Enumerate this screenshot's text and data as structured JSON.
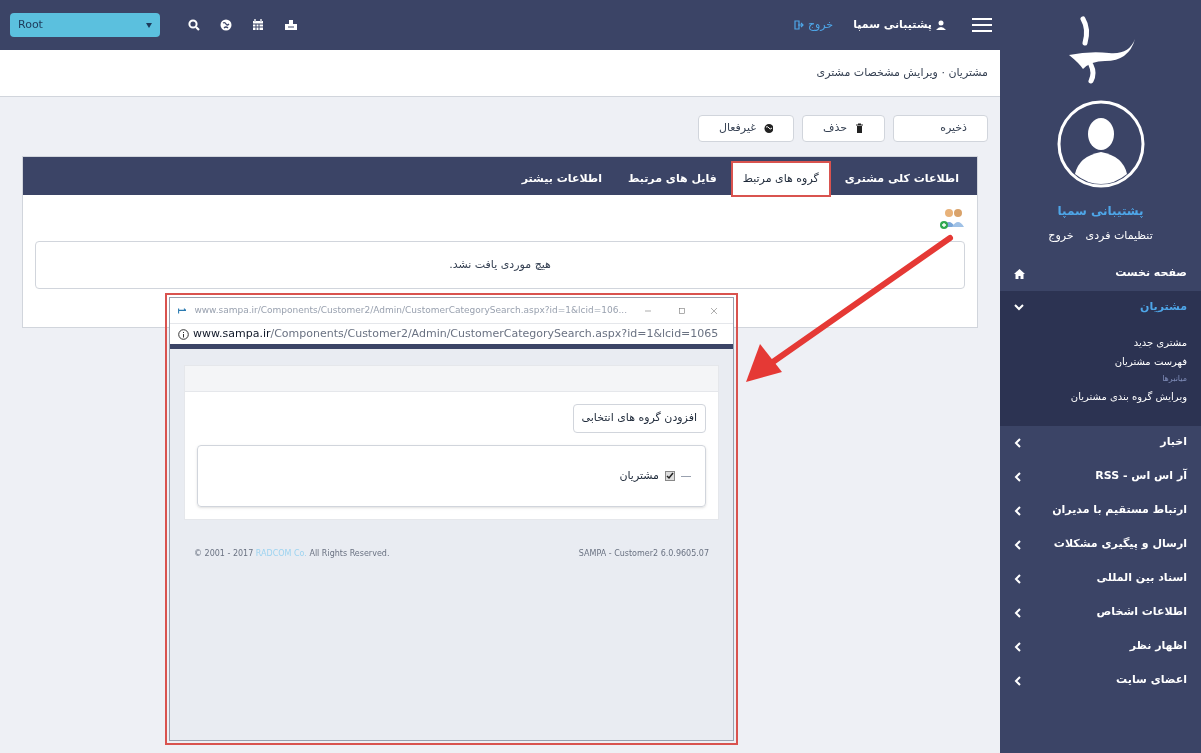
{
  "top_bar": {
    "dropdown": {
      "value": "Root"
    },
    "user_name": "پشتیبانی سمپا",
    "logout": "خروج"
  },
  "breadcrumb": "مشتریان · ویرایش مشخصات مشتری",
  "toolbar": [
    {
      "label": "ذخیره",
      "kind": "plain"
    },
    {
      "label": "حذف",
      "kind": "trash"
    },
    {
      "label": "غیرفعال",
      "kind": "globe"
    }
  ],
  "tabs": [
    {
      "label": "اطلاعات کلی مشتری",
      "selected": false,
      "highlighted": false
    },
    {
      "label": "گروه های مرتبط",
      "selected": true,
      "highlighted": true
    },
    {
      "label": "فایل های مرتبط",
      "selected": false,
      "highlighted": false
    },
    {
      "label": "اطلاعات بیشتر",
      "selected": false,
      "highlighted": false
    }
  ],
  "empty_message": "هیچ موردی یافت نشد.",
  "popup": {
    "title": "www.sampa.ir/Components/Customer2/Admin/CustomerCategorySearch.aspx?id=1&lcid=106...",
    "url": "**www.sampa.ir**/Components/Customer2/Admin/CustomerCategorySearch.aspx?id=1&lcid=1065",
    "add_button": "افزودن گروه های انتخابی",
    "tree": [
      {
        "label": "مشتریان",
        "checked": true
      }
    ],
    "footer": {
      "copyright_start": "© 2001 - 2017 ",
      "company": "RADCOM Co.",
      "copyright_end": " All Rights Reserved.",
      "version": "SAMPA - Customer2 6.0.9605.07"
    }
  },
  "sidebar": {
    "user_name": "پشتیبانی سمپا",
    "links": [
      "تنظیمات فردی",
      "خروج"
    ],
    "menu": [
      {
        "label": "صفحه نخست",
        "kind": "home",
        "expanded": false
      },
      {
        "label": "مشتریان",
        "kind": "group",
        "expanded": true,
        "children": [
          {
            "label": "مشتری جدید",
            "kind": "link"
          },
          {
            "label": "فهرست مشتریان",
            "kind": "link"
          },
          {
            "label": "میانبرها",
            "kind": "heading"
          },
          {
            "label": "ویرایش گروه بندی مشتریان",
            "kind": "link"
          }
        ]
      },
      {
        "label": "اخبار",
        "kind": "group",
        "expanded": false
      },
      {
        "label": "آر اس اس - RSS",
        "kind": "group",
        "expanded": false
      },
      {
        "label": "ارتباط مستقیم با مدیران",
        "kind": "group",
        "expanded": false
      },
      {
        "label": "ارسال و پیگیری مشکلات",
        "kind": "group",
        "expanded": false
      },
      {
        "label": "اسناد بین المللی",
        "kind": "group",
        "expanded": false
      },
      {
        "label": "اطلاعات اشخاص",
        "kind": "group",
        "expanded": false
      },
      {
        "label": "اظهار نظر",
        "kind": "group",
        "expanded": false
      },
      {
        "label": "اعضای سایت",
        "kind": "group",
        "expanded": false
      }
    ]
  }
}
